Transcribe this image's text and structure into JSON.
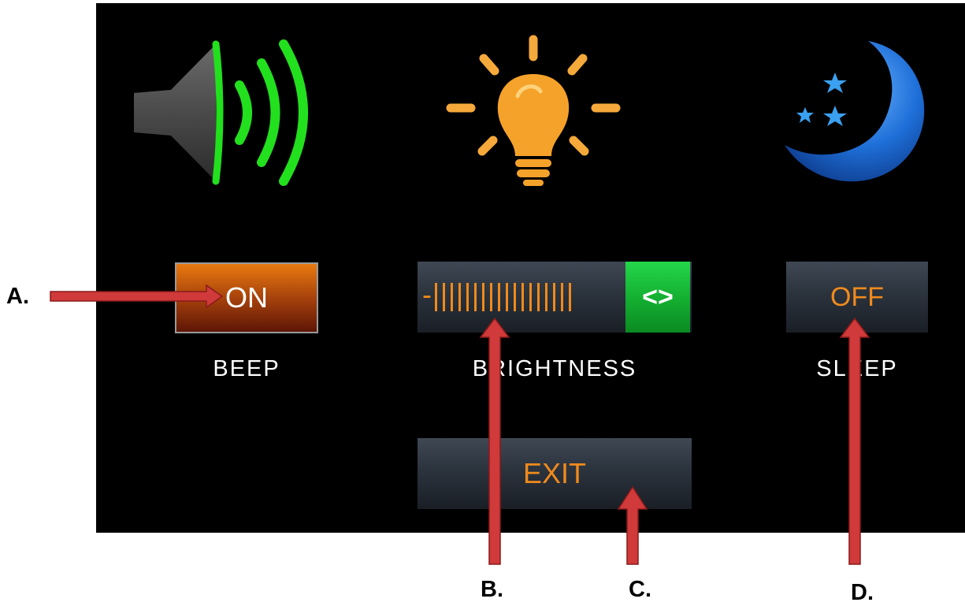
{
  "settings": {
    "beep": {
      "label": "BEEP",
      "value": "ON",
      "icon": "speaker-icon"
    },
    "brightness": {
      "label": "BRIGHTNESS",
      "handle_label": "<>",
      "minus_label": "-",
      "level_ticks": 18,
      "icon": "lightbulb-icon"
    },
    "sleep": {
      "label": "SLEEP",
      "value": "OFF",
      "icon": "moon-icon"
    }
  },
  "exit_label": "EXIT",
  "annotations": {
    "a": "A.",
    "b": "B.",
    "c": "C.",
    "d": "D."
  },
  "colors": {
    "accent_orange": "#f08a1c",
    "arrow_red": "#d03a3a",
    "handle_green": "#14b132",
    "speaker_green": "#22e01e",
    "moon_blue": "#1e6fd8"
  }
}
